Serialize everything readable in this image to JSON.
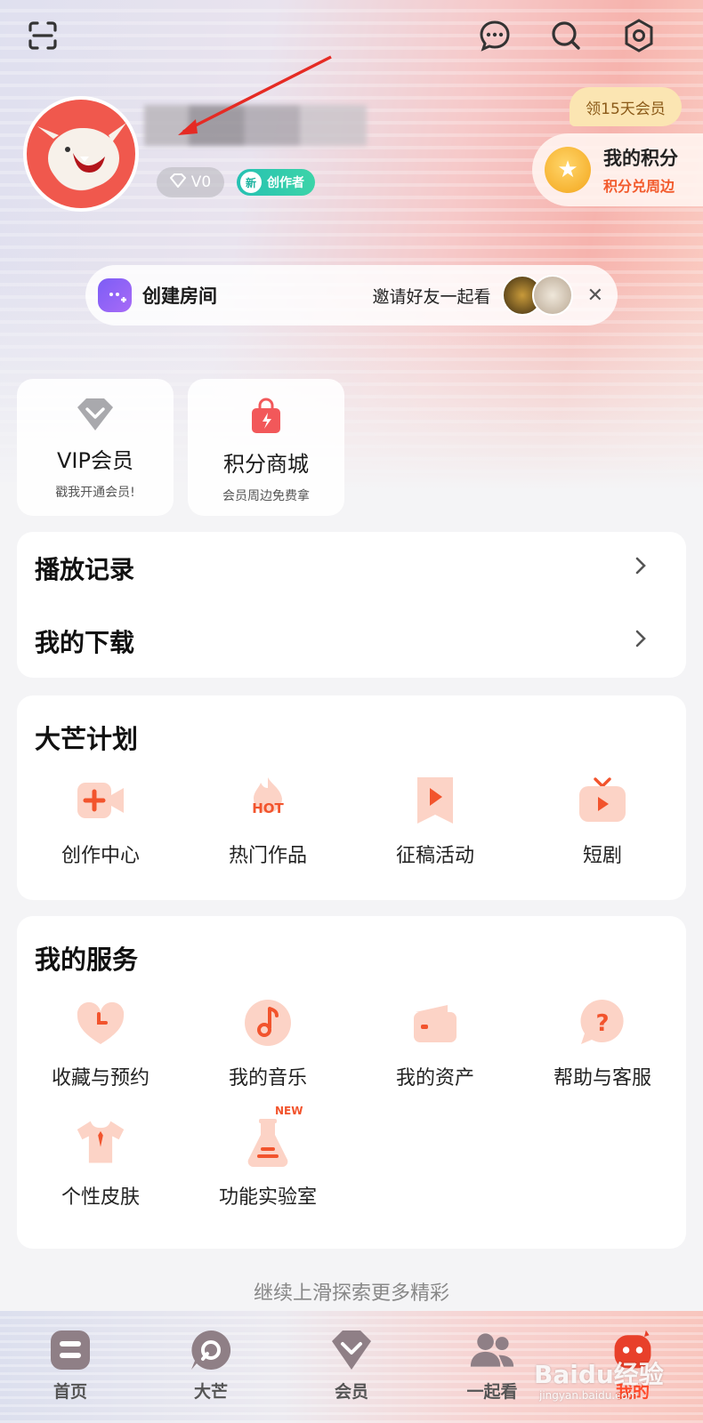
{
  "header": {
    "scan_icon": "scan-icon",
    "message_icon": "message-icon",
    "search_icon": "search-icon",
    "settings_icon": "settings-icon"
  },
  "profile": {
    "level": "V0",
    "creator_new": "新",
    "creator_label": "创作者"
  },
  "promo": {
    "vip_bubble": "领15天会员",
    "points_title": "我的积分",
    "points_sub": "积分兑周边"
  },
  "room": {
    "title": "创建房间",
    "invite": "邀请好友一起看",
    "close": "✕"
  },
  "quick_cards": [
    {
      "title": "VIP会员",
      "sub": "戳我开通会员!"
    },
    {
      "title": "积分商城",
      "sub": "会员周边免费拿"
    }
  ],
  "links": [
    {
      "label": "播放记录"
    },
    {
      "label": "我的下载"
    }
  ],
  "damang_plan": {
    "title": "大芒计划",
    "items": [
      {
        "label": "创作中心",
        "icon": "video-plus-icon"
      },
      {
        "label": "热门作品",
        "icon": "hot-flame-icon",
        "badge": "HOT"
      },
      {
        "label": "征稿活动",
        "icon": "play-bookmark-icon"
      },
      {
        "label": "短剧",
        "icon": "tv-play-icon"
      }
    ]
  },
  "services": {
    "title": "我的服务",
    "items": [
      {
        "label": "收藏与预约",
        "icon": "heart-clock-icon"
      },
      {
        "label": "我的音乐",
        "icon": "music-note-icon"
      },
      {
        "label": "我的资产",
        "icon": "wallet-icon"
      },
      {
        "label": "帮助与客服",
        "icon": "help-bubble-icon"
      },
      {
        "label": "个性皮肤",
        "icon": "tshirt-icon"
      },
      {
        "label": "功能实验室",
        "icon": "flask-icon",
        "badge": "NEW"
      }
    ]
  },
  "explore_hint": "继续上滑探索更多精彩",
  "tabs": [
    {
      "label": "首页",
      "icon": "home-icon"
    },
    {
      "label": "大芒",
      "icon": "damang-icon"
    },
    {
      "label": "会员",
      "icon": "vip-icon"
    },
    {
      "label": "一起看",
      "icon": "watch-together-icon"
    },
    {
      "label": "我的",
      "icon": "mine-icon"
    }
  ],
  "watermark": {
    "text": "Baidu经验",
    "sub": "jingyan.baidu.com"
  },
  "colors": {
    "accent": "#ff4a2a",
    "points_sub": "#f25a2c",
    "creator": "#26c1b2"
  }
}
